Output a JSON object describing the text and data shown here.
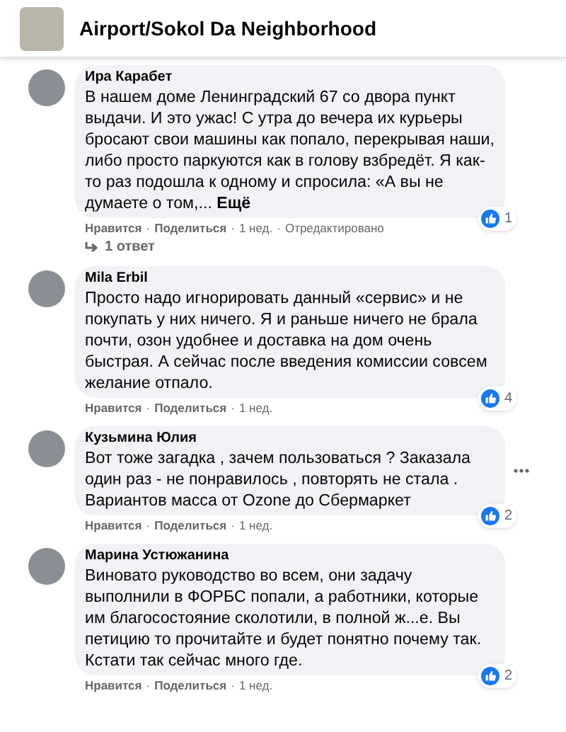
{
  "group": {
    "title": "Airport/Sokol Da Neighborhood"
  },
  "comments": [
    {
      "author": "Ира Карабет",
      "text": "В нашем доме Ленинградский 67 со двора пункт выдачи. И это ужас! С утра до вечера их курьеры бросают свои машины как попало, перекрывая наши, либо просто паркуются как в голову взбредёт. Я как-то раз подошла к одному и спросила: «А вы не думаете о том,...",
      "see_more": "Ещё",
      "actions": [
        "Нравится",
        "Поделиться"
      ],
      "time": "1 нед.",
      "edited": "Отредактировано",
      "reactions": "1",
      "replies": "1 ответ",
      "menu": false
    },
    {
      "author": "Mila Erbil",
      "text": "Просто надо игнорировать данный «сервис» и не покупать у них ничего. Я и раньше ничего не брала почти, озон удобнее и доставка на дом очень быстрая. А сейчас после введения комиссии совсем желание отпало.",
      "actions": [
        "Нравится",
        "Поделиться"
      ],
      "time": "1 нед.",
      "reactions": "4",
      "menu": false
    },
    {
      "author": "Кузьмина Юлия",
      "text": "Вот тоже загадка , зачем пользоваться ? Заказала один раз - не понравилось , повторять не стала . Вариантов масса от Ozone до Сбермаркет",
      "actions": [
        "Нравится",
        "Поделиться"
      ],
      "time": "1 нед.",
      "reactions": "2",
      "menu": true
    },
    {
      "author": "Марина Устюжанина",
      "text": "Виновато руководство во всем, они задачу выполнили в ФОРБС попали, а работники, которые им благосостояние сколотили, в полной ж...е. Вы петицию то прочитайте и будет понятно почему так. Кстати так сейчас много где.",
      "actions": [
        "Нравится",
        "Поделиться"
      ],
      "time": "1 нед.",
      "reactions": "2",
      "menu": false
    }
  ],
  "separator": "·"
}
